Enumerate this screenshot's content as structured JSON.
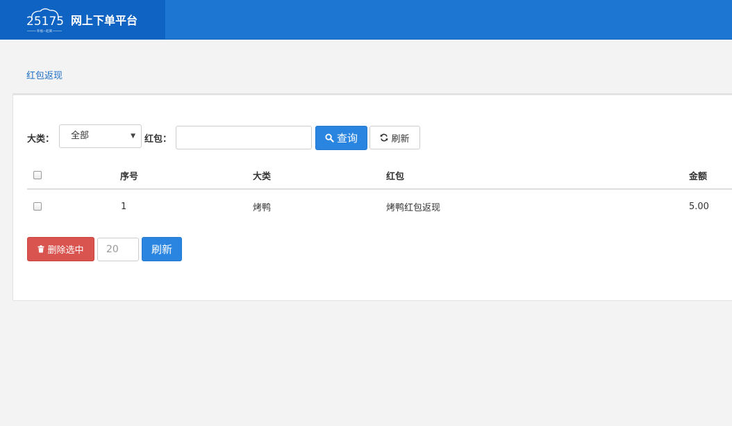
{
  "header": {
    "logo_text": "25175",
    "logo_tagline": "幸福一起来",
    "title": "网上下单平台"
  },
  "breadcrumb": "红包返现",
  "filters": {
    "category_label": "大类：",
    "category_value": "全部",
    "redpacket_label": "红包：",
    "redpacket_value": "",
    "query_label": "查询",
    "refresh_label": "刷新"
  },
  "table": {
    "columns": [
      "序号",
      "大类",
      "红包",
      "金额"
    ],
    "rows": [
      {
        "index": "1",
        "category": "烤鸭",
        "redpacket": "烤鸭红包返现",
        "amount": "5.00"
      }
    ]
  },
  "actions": {
    "delete_label": "删除选中",
    "page_size": "20",
    "refresh_label": "刷新"
  },
  "colors": {
    "header": "#1d77d2",
    "brand": "#0f63c2",
    "primary": "#2a85e0",
    "danger": "#d9534f"
  }
}
